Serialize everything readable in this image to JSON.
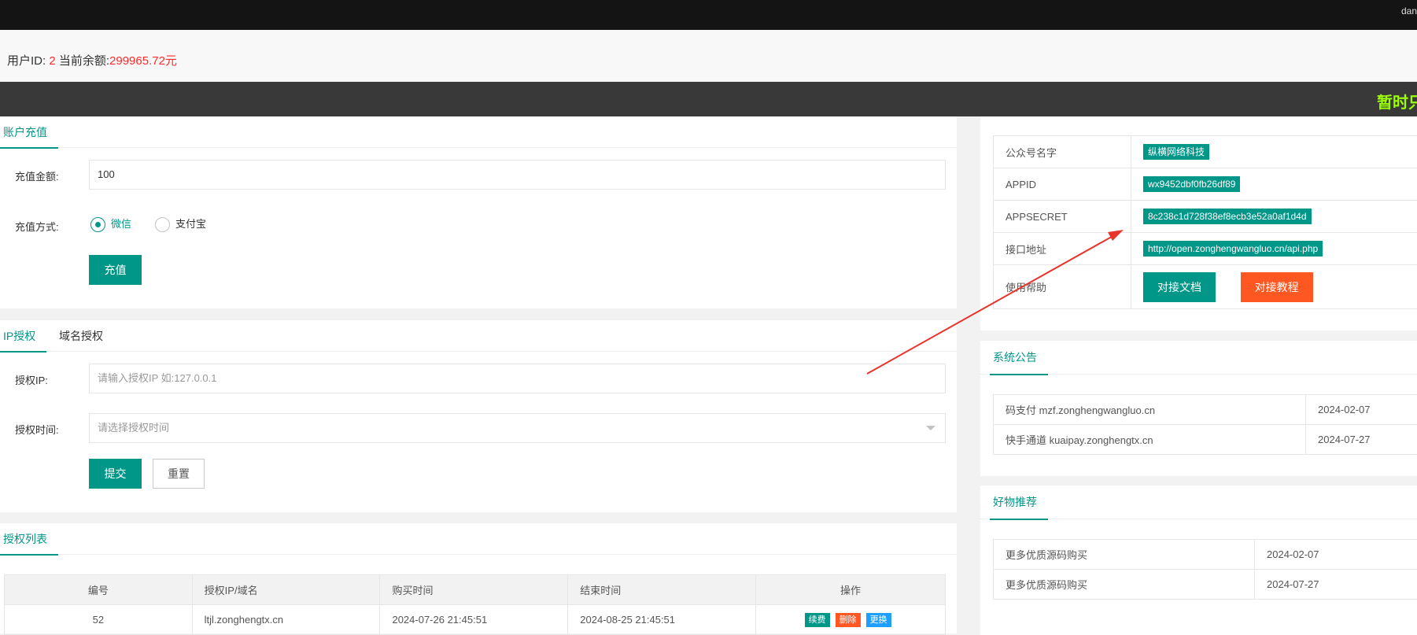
{
  "header": {
    "user_text": "dan"
  },
  "account": {
    "uid_label": "用户ID:",
    "uid": "2",
    "balance_label": "当前余额:",
    "balance": "299965.72元"
  },
  "notice": {
    "text": "暂时只"
  },
  "recharge": {
    "tab": "账户充值",
    "amount_label": "充值金额:",
    "amount_value": "100",
    "method_label": "充值方式:",
    "methods": [
      {
        "label": "微信",
        "selected": true
      },
      {
        "label": "支付宝",
        "selected": false
      }
    ],
    "submit": "充值"
  },
  "auth": {
    "tabs": [
      {
        "label": "IP授权",
        "active": true
      },
      {
        "label": "域名授权",
        "active": false
      }
    ],
    "ip_label": "授权IP:",
    "ip_placeholder": "请输入授权IP 如:127.0.0.1",
    "time_label": "授权时间:",
    "time_placeholder": "请选择授权时间",
    "submit": "提交",
    "reset": "重置"
  },
  "auth_list": {
    "tab": "授权列表",
    "columns": [
      "编号",
      "授权IP/域名",
      "购买时间",
      "结束时间",
      "操作"
    ],
    "rows": [
      {
        "id": "52",
        "domain": "ltjl.zonghengtx.cn",
        "buy": "2024-07-26 21:45:51",
        "end": "2024-08-25 21:45:51"
      }
    ],
    "actions": [
      "续费",
      "删除",
      "更换"
    ]
  },
  "api_info": {
    "rows": [
      {
        "label": "公众号名字",
        "value": "纵横网络科技"
      },
      {
        "label": "APPID",
        "value": "wx9452dbf0fb26df89"
      },
      {
        "label": "APPSECRET",
        "value": "8c238c1d728f38ef8ecb3e52a0af1d4d"
      },
      {
        "label": "接口地址",
        "value": "http://open.zonghengwangluo.cn/api.php"
      }
    ],
    "help_label": "使用帮助",
    "doc_button": "对接文档",
    "tutorial_button": "对接教程"
  },
  "announcements": {
    "tab": "系统公告",
    "items": [
      {
        "text": "码支付 mzf.zonghengwangluo.cn",
        "date": "2024-02-07"
      },
      {
        "text": "快手通道 kuaipay.zonghengtx.cn",
        "date": "2024-07-27"
      }
    ]
  },
  "recommend": {
    "tab": "好物推荐",
    "items": [
      {
        "text": "更多优质源码购买",
        "date": "2024-02-07"
      },
      {
        "text": "更多优质源码购买",
        "date": "2024-07-27"
      }
    ]
  },
  "colors": {
    "primary": "#009688",
    "danger": "#ff5722",
    "info": "#1e9fff",
    "balance": "#ff2a2a",
    "marquee": "#9aff00",
    "arrow": "#e8342a"
  }
}
